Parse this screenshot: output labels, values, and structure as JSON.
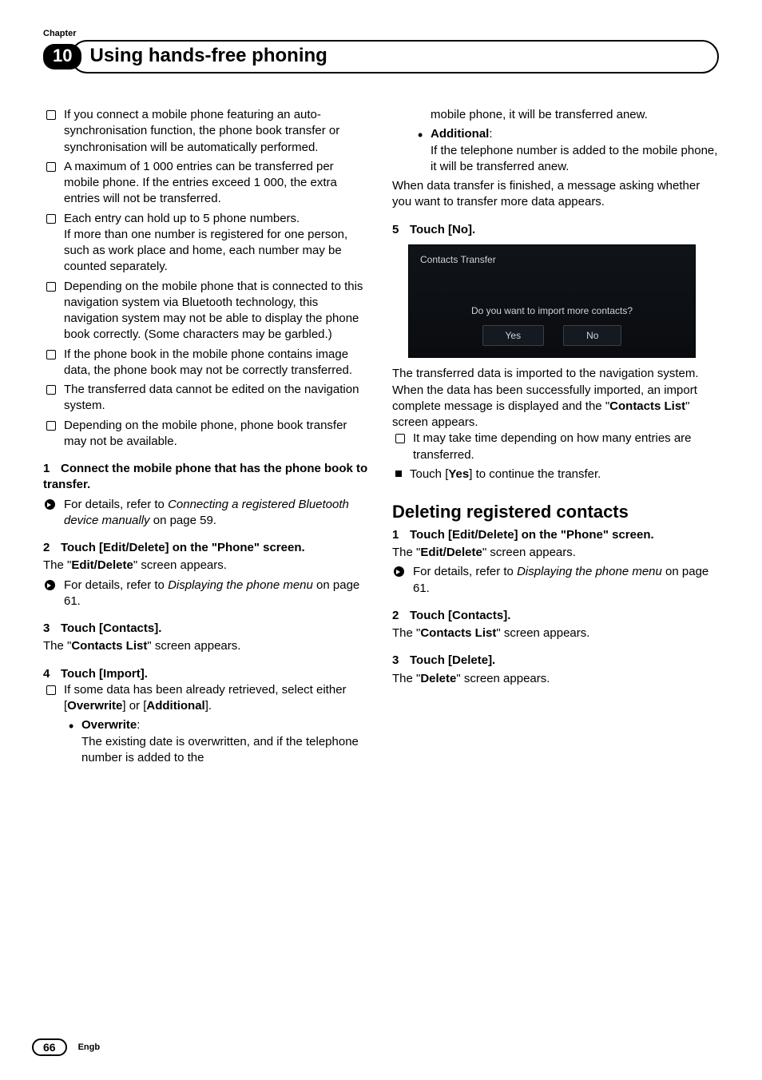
{
  "header": {
    "chapter_label": "Chapter",
    "chapter_number": "10",
    "title": "Using hands-free phoning"
  },
  "col1": {
    "notes": [
      "If you connect a mobile phone featuring an auto-synchronisation function, the phone book transfer or synchronisation will be automatically performed.",
      "A maximum of 1 000 entries can be transferred per mobile phone. If the entries exceed 1 000, the extra entries will not be transferred.",
      "Each entry can hold up to 5 phone numbers.",
      "Depending on the mobile phone that is connected to this navigation system via Bluetooth technology, this navigation system may not be able to display the phone book correctly. (Some characters may be garbled.)",
      "If the phone book in the mobile phone contains image data, the phone book may not be correctly transferred.",
      "The transferred data cannot be edited on the navigation system.",
      "Depending on the mobile phone, phone book transfer may not be available."
    ],
    "note3_extra": "If more than one number is registered for one person, such as work place and home, each number may be counted separately.",
    "step1": "Connect the mobile phone that has the phone book to transfer.",
    "step1_ref_pre": "For details, refer to ",
    "step1_ref_it": "Connecting a registered Bluetooth device manually",
    "step1_ref_post": " on page 59.",
    "step2": "Touch [Edit/Delete] on the \"Phone\" screen.",
    "step2_body_pre": "The \"",
    "step2_body_bold": "Edit/Delete",
    "step2_body_post": "\" screen appears.",
    "step2_ref_pre": "For details, refer to ",
    "step2_ref_it": "Displaying the phone menu",
    "step2_ref_post": " on page 61.",
    "step3": "Touch [Contacts].",
    "step3_body_pre": "The \"",
    "step3_body_bold": "Contacts List",
    "step3_body_post": "\" screen appears.",
    "step4": "Touch [Import].",
    "step4_note_pre": "If some data has been already retrieved, select either [",
    "step4_note_b1": "Overwrite",
    "step4_note_mid": "] or [",
    "step4_note_b2": "Additional",
    "step4_note_post": "].",
    "overwrite_label": "Overwrite",
    "overwrite_text": "The existing date is overwritten, and if the telephone number is added to the"
  },
  "col2": {
    "overwrite_cont": "mobile phone, it will be transferred anew.",
    "additional_label": "Additional",
    "additional_text": "If the telephone number is added to the mobile phone, it will be transferred anew.",
    "after_transfer": "When data transfer is finished, a message asking whether you want to transfer more data appears.",
    "step5": "Touch [No].",
    "shot": {
      "title": "Contacts Transfer",
      "message": "Do you want to import more contacts?",
      "yes": "Yes",
      "no": "No"
    },
    "after_shot1": "The transferred data is imported to the navigation system.",
    "after_shot2_pre": "When the data has been successfully imported, an import complete message is displayed and the \"",
    "after_shot2_bold": "Contacts List",
    "after_shot2_post": "\" screen appears.",
    "import_note": "It may take time depending on how many entries are transferred.",
    "yes_note_pre": "Touch [",
    "yes_note_bold": "Yes",
    "yes_note_post": "] to continue the transfer.",
    "section_title": "Deleting registered contacts",
    "d_step1": "Touch [Edit/Delete] on the \"Phone\" screen.",
    "d_step1_body_pre": "The \"",
    "d_step1_body_bold": "Edit/Delete",
    "d_step1_body_post": "\" screen appears.",
    "d_step1_ref_pre": "For details, refer to ",
    "d_step1_ref_it": "Displaying the phone menu",
    "d_step1_ref_post": " on page 61.",
    "d_step2": "Touch [Contacts].",
    "d_step2_body_pre": "The \"",
    "d_step2_body_bold": "Contacts List",
    "d_step2_body_post": "\" screen appears.",
    "d_step3": "Touch [Delete].",
    "d_step3_body_pre": "The \"",
    "d_step3_body_bold": "Delete",
    "d_step3_body_post": "\" screen appears."
  },
  "footer": {
    "page": "66",
    "lang": "Engb"
  }
}
